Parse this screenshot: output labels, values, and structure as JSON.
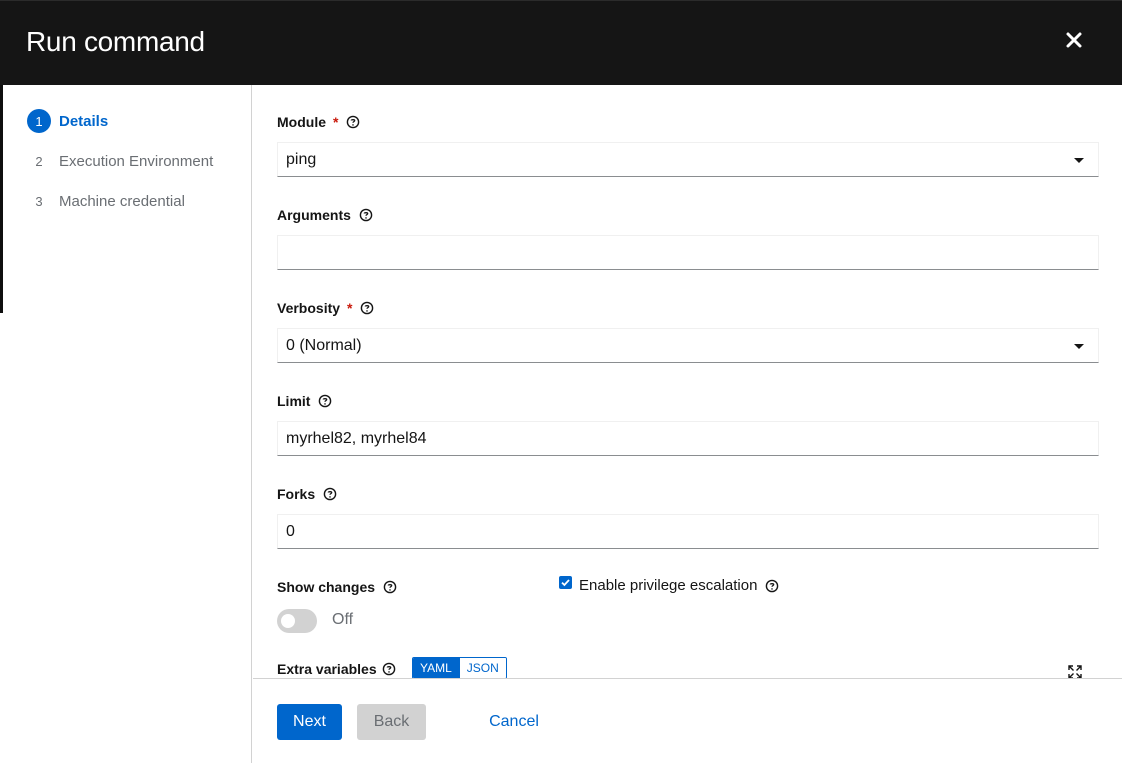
{
  "modal": {
    "title": "Run command"
  },
  "wizard": {
    "steps": [
      {
        "number": "1",
        "label": "Details"
      },
      {
        "number": "2",
        "label": "Execution Environment"
      },
      {
        "number": "3",
        "label": "Machine credential"
      }
    ]
  },
  "form": {
    "module": {
      "label": "Module",
      "value": "ping"
    },
    "arguments": {
      "label": "Arguments",
      "value": ""
    },
    "verbosity": {
      "label": "Verbosity",
      "value": "0 (Normal)"
    },
    "limit": {
      "label": "Limit",
      "value": "myrhel82, myrhel84"
    },
    "forks": {
      "label": "Forks",
      "value": "0"
    },
    "show_changes": {
      "label": "Show changes",
      "state_label": "Off"
    },
    "privilege_escalation": {
      "label": "Enable privilege escalation"
    },
    "extra_variables": {
      "label": "Extra variables",
      "yaml": "YAML",
      "json": "JSON"
    }
  },
  "footer": {
    "next": "Next",
    "back": "Back",
    "cancel": "Cancel"
  },
  "colors": {
    "accent": "#0066cc",
    "header_bg": "#151515",
    "required": "#c9190b"
  },
  "icons": [
    "close-icon",
    "help-icon",
    "caret-down-icon",
    "checkmark-icon",
    "expand-icon"
  ]
}
